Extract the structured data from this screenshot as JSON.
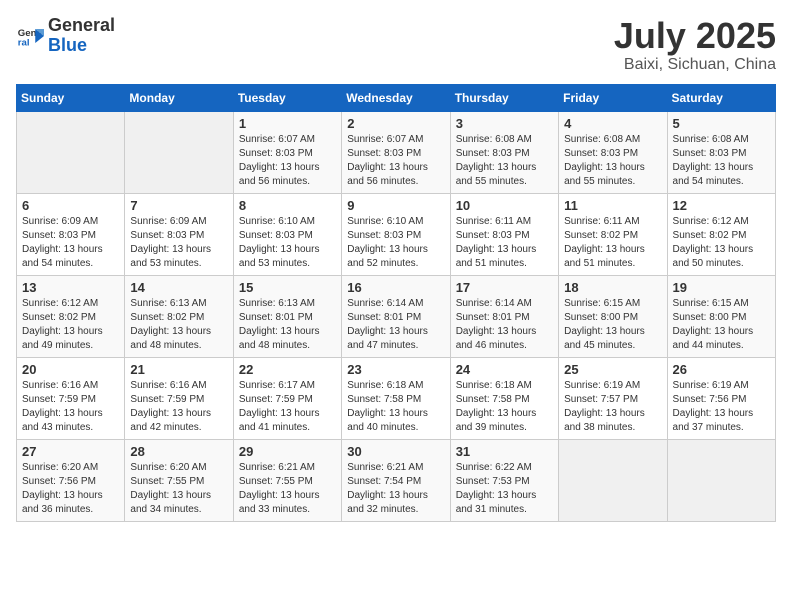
{
  "header": {
    "logo_general": "General",
    "logo_blue": "Blue",
    "month": "July 2025",
    "location": "Baixi, Sichuan, China"
  },
  "days_of_week": [
    "Sunday",
    "Monday",
    "Tuesday",
    "Wednesday",
    "Thursday",
    "Friday",
    "Saturday"
  ],
  "weeks": [
    [
      {
        "day": "",
        "info": ""
      },
      {
        "day": "",
        "info": ""
      },
      {
        "day": "1",
        "info": "Sunrise: 6:07 AM\nSunset: 8:03 PM\nDaylight: 13 hours and 56 minutes."
      },
      {
        "day": "2",
        "info": "Sunrise: 6:07 AM\nSunset: 8:03 PM\nDaylight: 13 hours and 56 minutes."
      },
      {
        "day": "3",
        "info": "Sunrise: 6:08 AM\nSunset: 8:03 PM\nDaylight: 13 hours and 55 minutes."
      },
      {
        "day": "4",
        "info": "Sunrise: 6:08 AM\nSunset: 8:03 PM\nDaylight: 13 hours and 55 minutes."
      },
      {
        "day": "5",
        "info": "Sunrise: 6:08 AM\nSunset: 8:03 PM\nDaylight: 13 hours and 54 minutes."
      }
    ],
    [
      {
        "day": "6",
        "info": "Sunrise: 6:09 AM\nSunset: 8:03 PM\nDaylight: 13 hours and 54 minutes."
      },
      {
        "day": "7",
        "info": "Sunrise: 6:09 AM\nSunset: 8:03 PM\nDaylight: 13 hours and 53 minutes."
      },
      {
        "day": "8",
        "info": "Sunrise: 6:10 AM\nSunset: 8:03 PM\nDaylight: 13 hours and 53 minutes."
      },
      {
        "day": "9",
        "info": "Sunrise: 6:10 AM\nSunset: 8:03 PM\nDaylight: 13 hours and 52 minutes."
      },
      {
        "day": "10",
        "info": "Sunrise: 6:11 AM\nSunset: 8:03 PM\nDaylight: 13 hours and 51 minutes."
      },
      {
        "day": "11",
        "info": "Sunrise: 6:11 AM\nSunset: 8:02 PM\nDaylight: 13 hours and 51 minutes."
      },
      {
        "day": "12",
        "info": "Sunrise: 6:12 AM\nSunset: 8:02 PM\nDaylight: 13 hours and 50 minutes."
      }
    ],
    [
      {
        "day": "13",
        "info": "Sunrise: 6:12 AM\nSunset: 8:02 PM\nDaylight: 13 hours and 49 minutes."
      },
      {
        "day": "14",
        "info": "Sunrise: 6:13 AM\nSunset: 8:02 PM\nDaylight: 13 hours and 48 minutes."
      },
      {
        "day": "15",
        "info": "Sunrise: 6:13 AM\nSunset: 8:01 PM\nDaylight: 13 hours and 48 minutes."
      },
      {
        "day": "16",
        "info": "Sunrise: 6:14 AM\nSunset: 8:01 PM\nDaylight: 13 hours and 47 minutes."
      },
      {
        "day": "17",
        "info": "Sunrise: 6:14 AM\nSunset: 8:01 PM\nDaylight: 13 hours and 46 minutes."
      },
      {
        "day": "18",
        "info": "Sunrise: 6:15 AM\nSunset: 8:00 PM\nDaylight: 13 hours and 45 minutes."
      },
      {
        "day": "19",
        "info": "Sunrise: 6:15 AM\nSunset: 8:00 PM\nDaylight: 13 hours and 44 minutes."
      }
    ],
    [
      {
        "day": "20",
        "info": "Sunrise: 6:16 AM\nSunset: 7:59 PM\nDaylight: 13 hours and 43 minutes."
      },
      {
        "day": "21",
        "info": "Sunrise: 6:16 AM\nSunset: 7:59 PM\nDaylight: 13 hours and 42 minutes."
      },
      {
        "day": "22",
        "info": "Sunrise: 6:17 AM\nSunset: 7:59 PM\nDaylight: 13 hours and 41 minutes."
      },
      {
        "day": "23",
        "info": "Sunrise: 6:18 AM\nSunset: 7:58 PM\nDaylight: 13 hours and 40 minutes."
      },
      {
        "day": "24",
        "info": "Sunrise: 6:18 AM\nSunset: 7:58 PM\nDaylight: 13 hours and 39 minutes."
      },
      {
        "day": "25",
        "info": "Sunrise: 6:19 AM\nSunset: 7:57 PM\nDaylight: 13 hours and 38 minutes."
      },
      {
        "day": "26",
        "info": "Sunrise: 6:19 AM\nSunset: 7:56 PM\nDaylight: 13 hours and 37 minutes."
      }
    ],
    [
      {
        "day": "27",
        "info": "Sunrise: 6:20 AM\nSunset: 7:56 PM\nDaylight: 13 hours and 36 minutes."
      },
      {
        "day": "28",
        "info": "Sunrise: 6:20 AM\nSunset: 7:55 PM\nDaylight: 13 hours and 34 minutes."
      },
      {
        "day": "29",
        "info": "Sunrise: 6:21 AM\nSunset: 7:55 PM\nDaylight: 13 hours and 33 minutes."
      },
      {
        "day": "30",
        "info": "Sunrise: 6:21 AM\nSunset: 7:54 PM\nDaylight: 13 hours and 32 minutes."
      },
      {
        "day": "31",
        "info": "Sunrise: 6:22 AM\nSunset: 7:53 PM\nDaylight: 13 hours and 31 minutes."
      },
      {
        "day": "",
        "info": ""
      },
      {
        "day": "",
        "info": ""
      }
    ]
  ]
}
